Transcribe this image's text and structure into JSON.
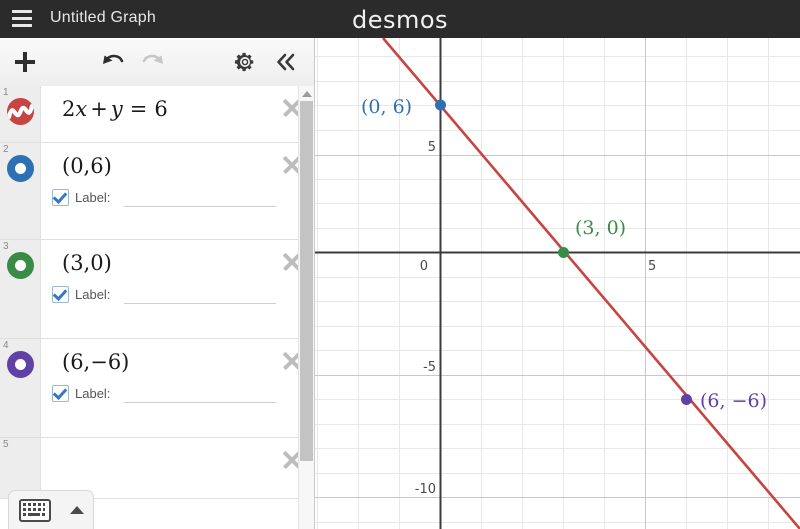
{
  "header": {
    "menu_icon": "hamburger-icon",
    "title": "Untitled Graph",
    "logo": "desmos"
  },
  "toolbar": {
    "add_label": "+",
    "add_icon": "plus-icon",
    "undo_icon": "undo-arrow-icon",
    "redo_icon": "redo-arrow-icon",
    "settings_icon": "gear-icon",
    "collapse_icon": "double-chevron-left-icon",
    "undo_enabled": true,
    "redo_enabled": false
  },
  "expressions": [
    {
      "index": "1",
      "type": "equation",
      "color": "#c74440",
      "icon": "curve-style-icon",
      "math_parts": {
        "coef": "2",
        "xvar": "x",
        "plus": "+",
        "yvar": "y",
        "eq": "=",
        "rhs": "6"
      },
      "text": "2x + y = 6",
      "has_label_row": false,
      "delete_icon": "close-icon"
    },
    {
      "index": "2",
      "type": "point",
      "color": "#2d70b3",
      "icon": "point-style-icon",
      "text": "(0,6)",
      "has_label_row": true,
      "label_checked": true,
      "label_caption": "Label:",
      "label_value": "",
      "delete_icon": "close-icon"
    },
    {
      "index": "3",
      "type": "point",
      "color": "#388c46",
      "icon": "point-style-icon",
      "text": "(3,0)",
      "has_label_row": true,
      "label_checked": true,
      "label_caption": "Label:",
      "label_value": "",
      "delete_icon": "close-icon"
    },
    {
      "index": "4",
      "type": "point",
      "color": "#6042a6",
      "icon": "point-style-icon",
      "text": "(6,−6)",
      "has_label_row": true,
      "label_checked": true,
      "label_caption": "Label:",
      "label_value": "",
      "delete_icon": "close-icon"
    },
    {
      "index": "5",
      "type": "empty",
      "color": "",
      "icon": "",
      "text": "",
      "has_label_row": false,
      "delete_icon": "close-icon"
    }
  ],
  "keyboard": {
    "keyboard_icon": "keyboard-icon",
    "expand_icon": "triangle-up-icon"
  },
  "scrollbar": {
    "up_icon": "triangle-up-icon"
  },
  "chart_data": {
    "type": "line",
    "title": "",
    "xlabel": "",
    "ylabel": "",
    "equation": "2x + y = 6",
    "slope": -2,
    "intercept": 6,
    "grid": true,
    "xlim": [
      -2.6,
      8.8
    ],
    "ylim": [
      -11.2,
      8.8
    ],
    "xticks": [
      0,
      5
    ],
    "xtick_labels": [
      "0",
      "5"
    ],
    "yticks": [
      5,
      -5,
      -10
    ],
    "ytick_labels": [
      "5",
      "-5",
      "-10"
    ],
    "line_color": "#c74440",
    "points": [
      {
        "x": 0,
        "y": 6,
        "label": "(0, 6)",
        "color": "#2d70b3",
        "label_side": "left"
      },
      {
        "x": 3,
        "y": 0,
        "label": "(3, 0)",
        "color": "#388c46",
        "label_side": "upright"
      },
      {
        "x": 6,
        "y": -6,
        "label": "(6, −6)",
        "color": "#6042a6",
        "label_side": "right"
      }
    ]
  }
}
